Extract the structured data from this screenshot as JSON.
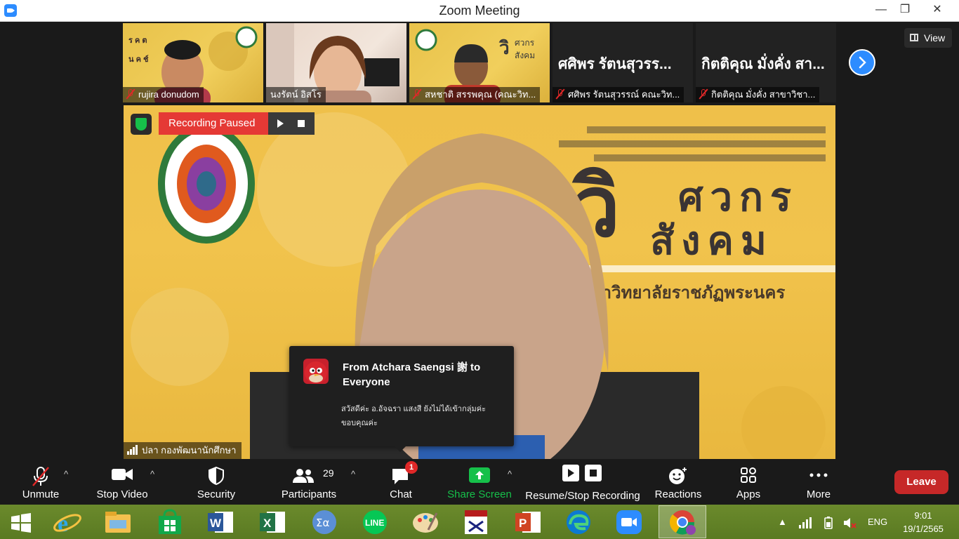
{
  "window": {
    "title": "Zoom Meeting",
    "minimize": "—",
    "maximize": "❐",
    "close": "✕"
  },
  "gallery": {
    "view_label": "View",
    "tiles": [
      {
        "name": "rujira donudom"
      },
      {
        "name": "นงรัตน์ อิสโร"
      },
      {
        "name": "สหชาติ สรรพคุณ (คณะวิท..."
      },
      {
        "big": "ศศิพร รัตนสุวรร...",
        "name": "ศศิพร รัตนสุวรรณ์ คณะวิท..."
      },
      {
        "big": "กิตติคุณ  มั่งคั่ง สา...",
        "name": "กิตติคุณ  มั่งคั่ง สาขาวิชา..."
      }
    ]
  },
  "main": {
    "recording_label": "Recording Paused",
    "speaker_name": "ปลา กองพัฒนานักศึกษา"
  },
  "chat_toast": {
    "from": "From Atchara Saengsi 謝 to Everyone",
    "message": "สวัสดีค่ะ อ.อัจฉรา แสงสี ยังไม่ได้เข้ากลุ่มค่ะ ขอบคุณค่ะ"
  },
  "toolbar": {
    "unmute": "Unmute",
    "stop_video": "Stop Video",
    "security": "Security",
    "participants": "Participants",
    "participants_count": "29",
    "chat": "Chat",
    "chat_badge": "1",
    "share_screen": "Share Screen",
    "recording": "Resume/Stop Recording",
    "reactions": "Reactions",
    "apps": "Apps",
    "more": "More",
    "leave": "Leave"
  },
  "taskbar": {
    "lang": "ENG",
    "time": "9:01",
    "date": "19/1/2565",
    "apps": [
      "start-icon",
      "internet-explorer-icon",
      "file-explorer-icon",
      "store-icon",
      "word-icon",
      "excel-icon",
      "calculator-icon",
      "line-icon",
      "paint-icon",
      "lisrel-icon",
      "powerpoint-icon",
      "edge-icon",
      "zoom-icon",
      "chrome-icon"
    ]
  },
  "colors": {
    "zoom_blue": "#2d8cff",
    "leave_red": "#c62828",
    "recording_red": "#e53935",
    "share_green": "#16c04a"
  }
}
